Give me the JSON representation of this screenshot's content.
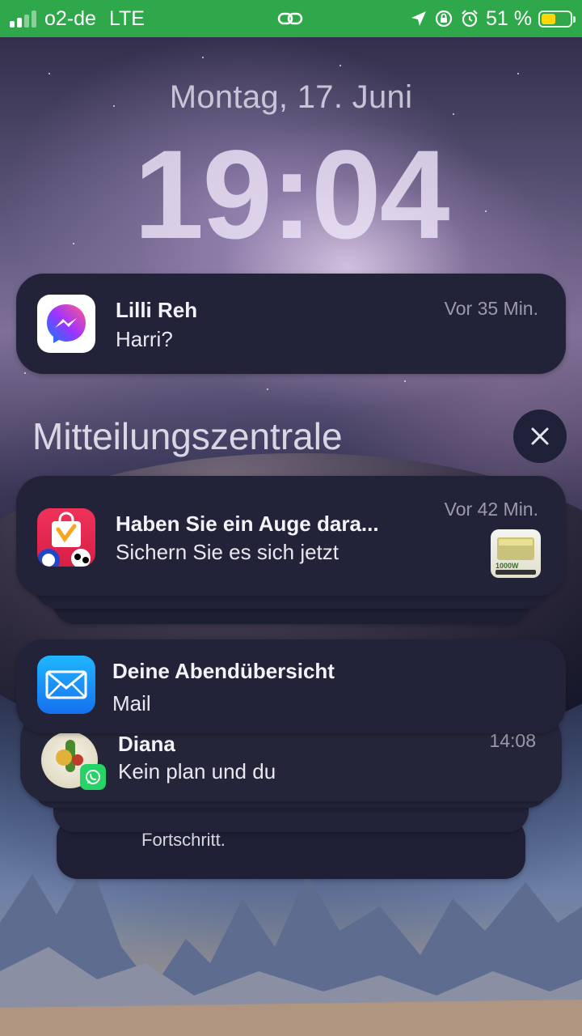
{
  "status_bar": {
    "carrier": "o2-de",
    "network": "LTE",
    "battery_text": "51 %",
    "battery_level": 0.51,
    "colors": {
      "background": "#2ea84a",
      "battery_fill": "#ffd60a"
    },
    "icons": [
      "signal-icon",
      "link-icon",
      "location-arrow-icon",
      "orientation-lock-icon",
      "alarm-icon",
      "battery-icon"
    ]
  },
  "lock_screen": {
    "date": "Montag, 17. Juni",
    "time": "19:04"
  },
  "notifications": {
    "messenger": {
      "app_icon": "messenger-icon",
      "title": "Lilli Reh",
      "body": "Harri?",
      "time": "Vor 35 Min."
    },
    "center_header": "Mitteilungszentrale",
    "close_icon": "close-icon",
    "shop": {
      "app_icon": "shopping-bag-icon",
      "title": "Haben Sie ein Auge dara...",
      "body": "Sichern Sie es sich jetzt",
      "time": "Vor 42 Min.",
      "thumbnail_text": "1000W"
    },
    "mail": {
      "app_icon": "mail-icon",
      "title": "Deine Abendübersicht",
      "body": "Mail"
    },
    "whatsapp": {
      "app_icon": "whatsapp-icon",
      "title": "Diana",
      "body": "Kein plan und du",
      "time": "14:08"
    },
    "stacked_fragment": {
      "body": "Fortschritt."
    }
  }
}
